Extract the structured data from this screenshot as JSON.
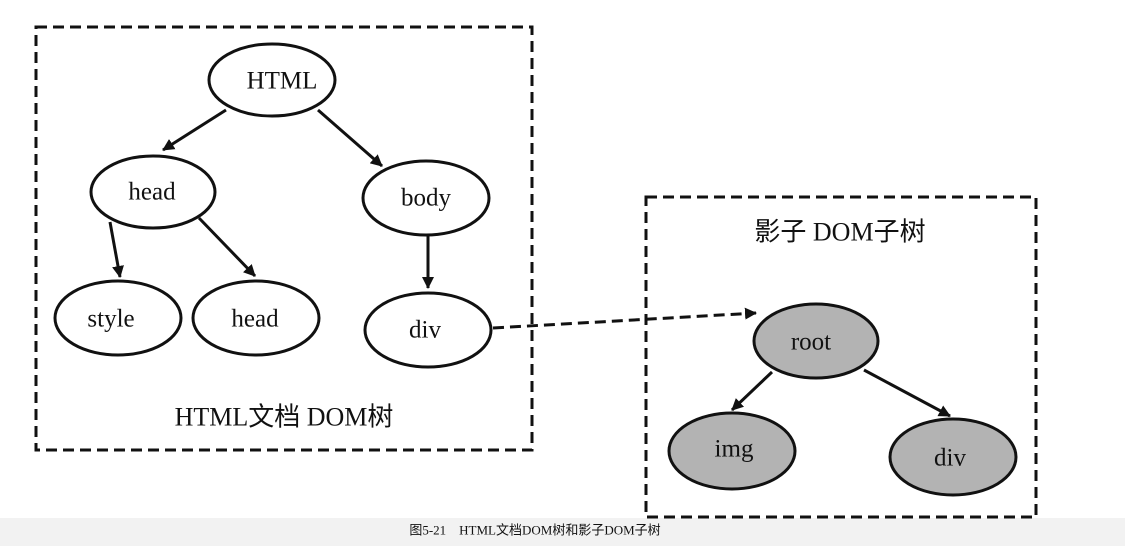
{
  "diagram": {
    "left_region": {
      "label": "HTML文档 DOM树",
      "nodes": {
        "html": "HTML",
        "head": "head",
        "body": "body",
        "style": "style",
        "head_child": "head",
        "div": "div"
      }
    },
    "right_region": {
      "label": "影子 DOM子树",
      "nodes": {
        "root": "root",
        "img": "img",
        "div": "div"
      }
    },
    "caption": "图5-21　HTML文档DOM树和影子DOM子树"
  },
  "colors": {
    "stroke": "#111111",
    "node_fill": "#ffffff",
    "shadow_node_fill": "#b3b3b3",
    "footer_band": "#f2f2f2"
  }
}
